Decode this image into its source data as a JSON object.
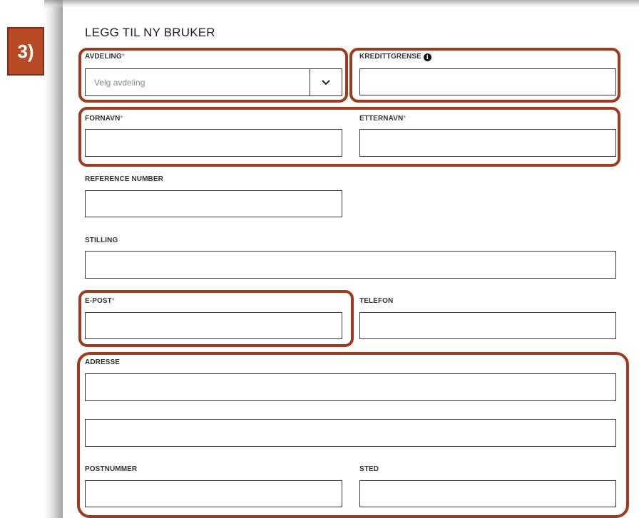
{
  "step_badge": "3)",
  "form": {
    "title": "LEGG TIL NY BRUKER",
    "required_marker": "*",
    "avdeling": {
      "label": "AVDELING",
      "placeholder": "Velg avdeling"
    },
    "kredittgrense": {
      "label": "KREDITTGRENSE",
      "info_glyph": "i"
    },
    "fornavn": {
      "label": "FORNAVN"
    },
    "etternavn": {
      "label": "ETTERNAVN"
    },
    "reference_number": {
      "label": "REFERENCE NUMBER"
    },
    "stilling": {
      "label": "STILLING"
    },
    "epost": {
      "label": "E-POST"
    },
    "telefon": {
      "label": "TELEFON"
    },
    "adresse": {
      "label": "ADRESSE"
    },
    "postnummer": {
      "label": "POSTNUMMER"
    },
    "sted": {
      "label": "STED"
    }
  },
  "colors": {
    "highlight": "#9e3b1e",
    "badge": "#b84a26",
    "required": "#c0504d"
  }
}
